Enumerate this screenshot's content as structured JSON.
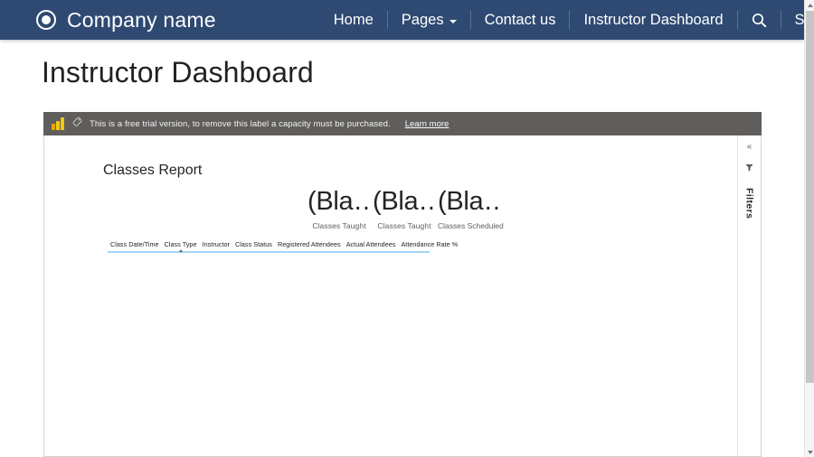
{
  "navbar": {
    "brand": "Company name",
    "brand_icon": "circle-target-icon",
    "links": [
      {
        "label": "Home",
        "icon": null
      },
      {
        "label": "Pages",
        "icon": "chevron-down-icon"
      },
      {
        "label": "Contact us",
        "icon": null
      },
      {
        "label": "Instructor Dashboard",
        "icon": null
      }
    ],
    "search_icon": "search-icon",
    "signin": "Sign in",
    "background_color": "#2e4a72",
    "text_color": "#ffffff"
  },
  "page": {
    "title": "Instructor Dashboard"
  },
  "powerbi": {
    "trial": {
      "logo_icon": "power-bi-logo-icon",
      "tag_icon": "tag-icon",
      "message": "This is a free trial version, to remove this label a capacity must be purchased.",
      "link_label": "Learn more",
      "background_color": "#605e5c"
    },
    "report": {
      "title": "Classes Report",
      "kpis": [
        {
          "value": "(Bla…",
          "label": "Classes Taught"
        },
        {
          "value": "(Bla…",
          "label": "Classes Taught"
        },
        {
          "value": "(Bla…",
          "label": "Classes Scheduled"
        }
      ],
      "table": {
        "columns": [
          {
            "label": "Class Date/Time",
            "sorted": false
          },
          {
            "label": "Class Type",
            "sorted": true
          },
          {
            "label": "Instructor",
            "sorted": false
          },
          {
            "label": "Class Status",
            "sorted": false
          },
          {
            "label": "Registered Attendees",
            "sorted": false
          },
          {
            "label": "Actual Attendees",
            "sorted": false
          },
          {
            "label": "Attendance Rate %",
            "sorted": false
          }
        ],
        "rows": [],
        "rule_color": "#a6d5f7"
      }
    },
    "filters_pane": {
      "collapse_icon": "chevron-double-left-icon",
      "collapse_glyph": "«",
      "filter_icon": "filter-icon",
      "label": "Filters",
      "collapsed": true
    }
  },
  "scrollbar": {
    "up_icon": "scroll-up-arrow-icon",
    "down_icon": "scroll-down-arrow-icon",
    "thumb": "scrollbar-thumb"
  }
}
